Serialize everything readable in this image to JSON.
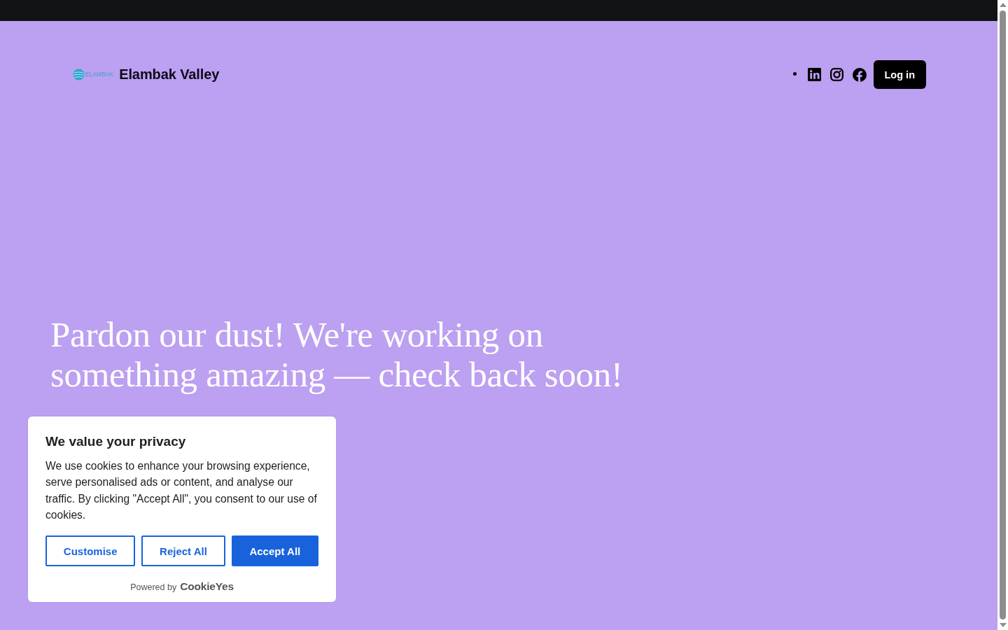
{
  "header": {
    "logo_text": "ELAMBAK",
    "site_title": "Elambak Valley",
    "social_links": [
      {
        "kind": "linkedin"
      },
      {
        "kind": "instagram"
      },
      {
        "kind": "facebook"
      }
    ],
    "login_button": "Log in"
  },
  "hero": {
    "heading": "Pardon our dust! We're working on something amazing — check back soon!"
  },
  "cookie_banner": {
    "title": "We value your privacy",
    "body": "We use cookies to enhance your browsing experience, serve personalised ads or content, and analyse our traffic. By clicking \"Accept All\", you consent to our use of cookies.",
    "buttons": [
      {
        "label": "Customise",
        "kind": "outline"
      },
      {
        "label": "Reject All",
        "kind": "outline"
      },
      {
        "label": "Accept All",
        "kind": "filled"
      }
    ],
    "powered_by": "Powered by",
    "brand": "CookieYes"
  }
}
